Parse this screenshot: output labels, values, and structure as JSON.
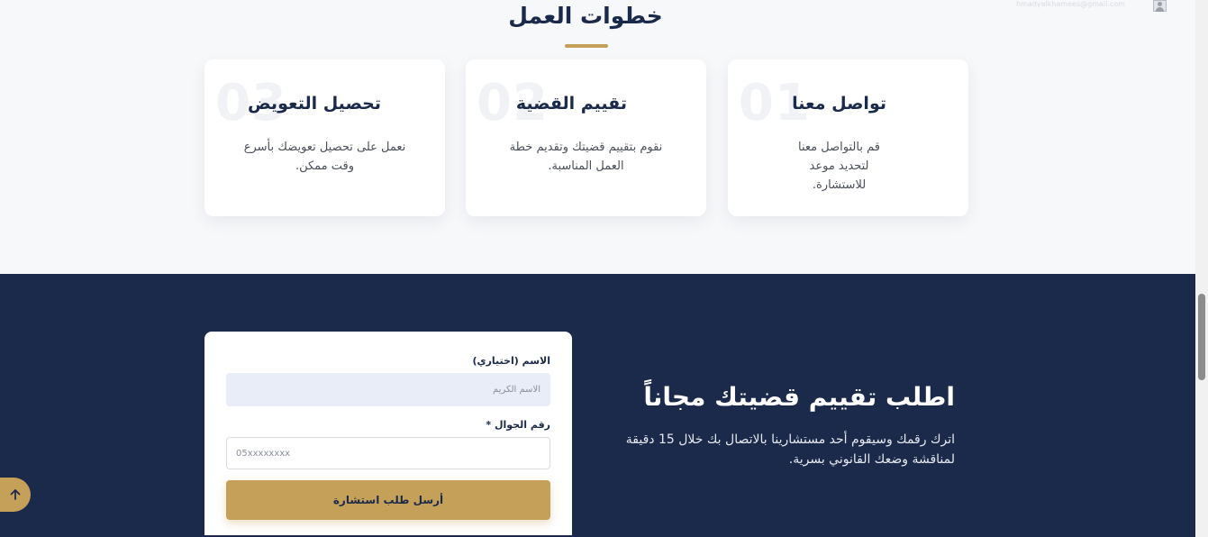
{
  "steps": {
    "title": "خطوات العمل",
    "cards": [
      {
        "number": "01",
        "heading": "تواصل معنا",
        "desc": "قم بالتواصل معنا لتحديد موعد للاستشارة."
      },
      {
        "number": "02",
        "heading": "تقييم القضية",
        "desc": "نقوم بتقييم قضيتك وتقديم خطة العمل المناسبة."
      },
      {
        "number": "03",
        "heading": "تحصيل التعويض",
        "desc": "نعمل على تحصيل تعويضك بأسرع وقت ممكن."
      }
    ]
  },
  "user": {
    "email": "hmadyalkhamees@gmail.com",
    "icon": "user-icon"
  },
  "consult": {
    "title": "اطلب تقييم قضيتك مجاناً",
    "desc": "اترك رقمك وسيقوم أحد مستشارينا بالاتصال بك خلال 15 دقيقة لمناقشة وضعك القانوني بسرية."
  },
  "form": {
    "name_label": "الاسم (اختياري)",
    "name_placeholder": "الاسم الكريم",
    "phone_label": "رقم الجوال *",
    "phone_placeholder": "05xxxxxxxx",
    "submit_label": "أرسل طلب استشارة"
  },
  "icons": {
    "scroll_top": "arrow-up-icon"
  },
  "colors": {
    "navy": "#1b2a4a",
    "gold": "#c5a059",
    "light_bg": "#f7f8fa"
  }
}
